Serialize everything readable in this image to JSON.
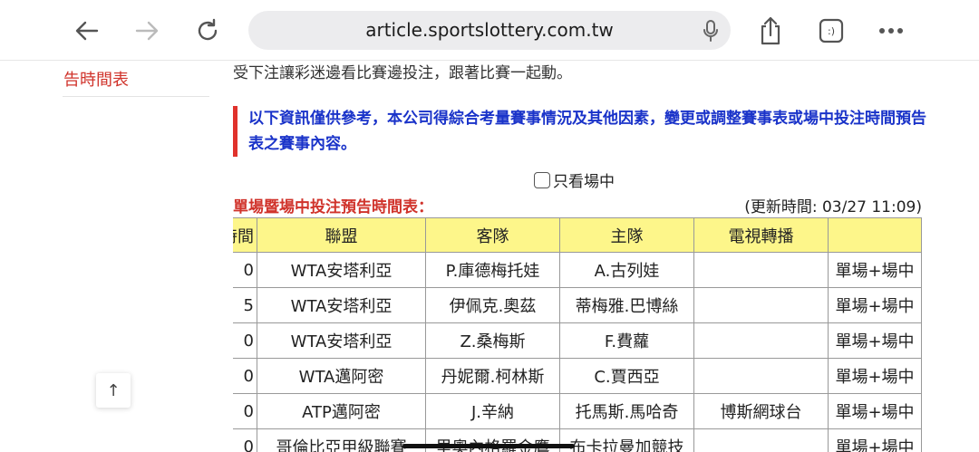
{
  "browser": {
    "url": "article.sportslottery.com.tw",
    "tabs_label": ":)"
  },
  "sidebar": {
    "link": "告時間表"
  },
  "article": {
    "intro": "受下注讓彩迷邊看比賽邊投注，跟著比賽一起動。",
    "notice": "以下資訊僅供參考，本公司得綜合考量賽事情況及其他因素，變更或調整賽事表或場中投注時間預告表之賽事內容。",
    "filter_label": "只看場中",
    "schedule_title": "單場暨場中投注預告時間表：",
    "updated": "(更新時間: 03/27 11:09)"
  },
  "table": {
    "headers": [
      "時間",
      "聯盟",
      "客隊",
      "主隊",
      "電視轉播",
      ""
    ],
    "rows": [
      [
        "0",
        "WTA安塔利亞",
        "P.庫德梅托娃",
        "A.古列娃",
        "",
        "單場+場中"
      ],
      [
        "5",
        "WTA安塔利亞",
        "伊佩克.奧茲",
        "蒂梅雅.巴博絲",
        "",
        "單場+場中"
      ],
      [
        "0",
        "WTA安塔利亞",
        "Z.桑梅斯",
        "F.費蘿",
        "",
        "單場+場中"
      ],
      [
        "0",
        "WTA邁阿密",
        "丹妮爾.柯林斯",
        "C.賈西亞",
        "",
        "單場+場中"
      ],
      [
        "0",
        "ATP邁阿密",
        "J.辛納",
        "托馬斯.馬哈奇",
        "博斯網球台",
        "單場+場中"
      ],
      [
        "0",
        "哥倫比亞甲級聯賽",
        "里奧內格羅金鷹",
        "布卡拉曼加競技",
        "",
        "單場+場中"
      ]
    ]
  },
  "scroll_top": {
    "label": "↑"
  }
}
